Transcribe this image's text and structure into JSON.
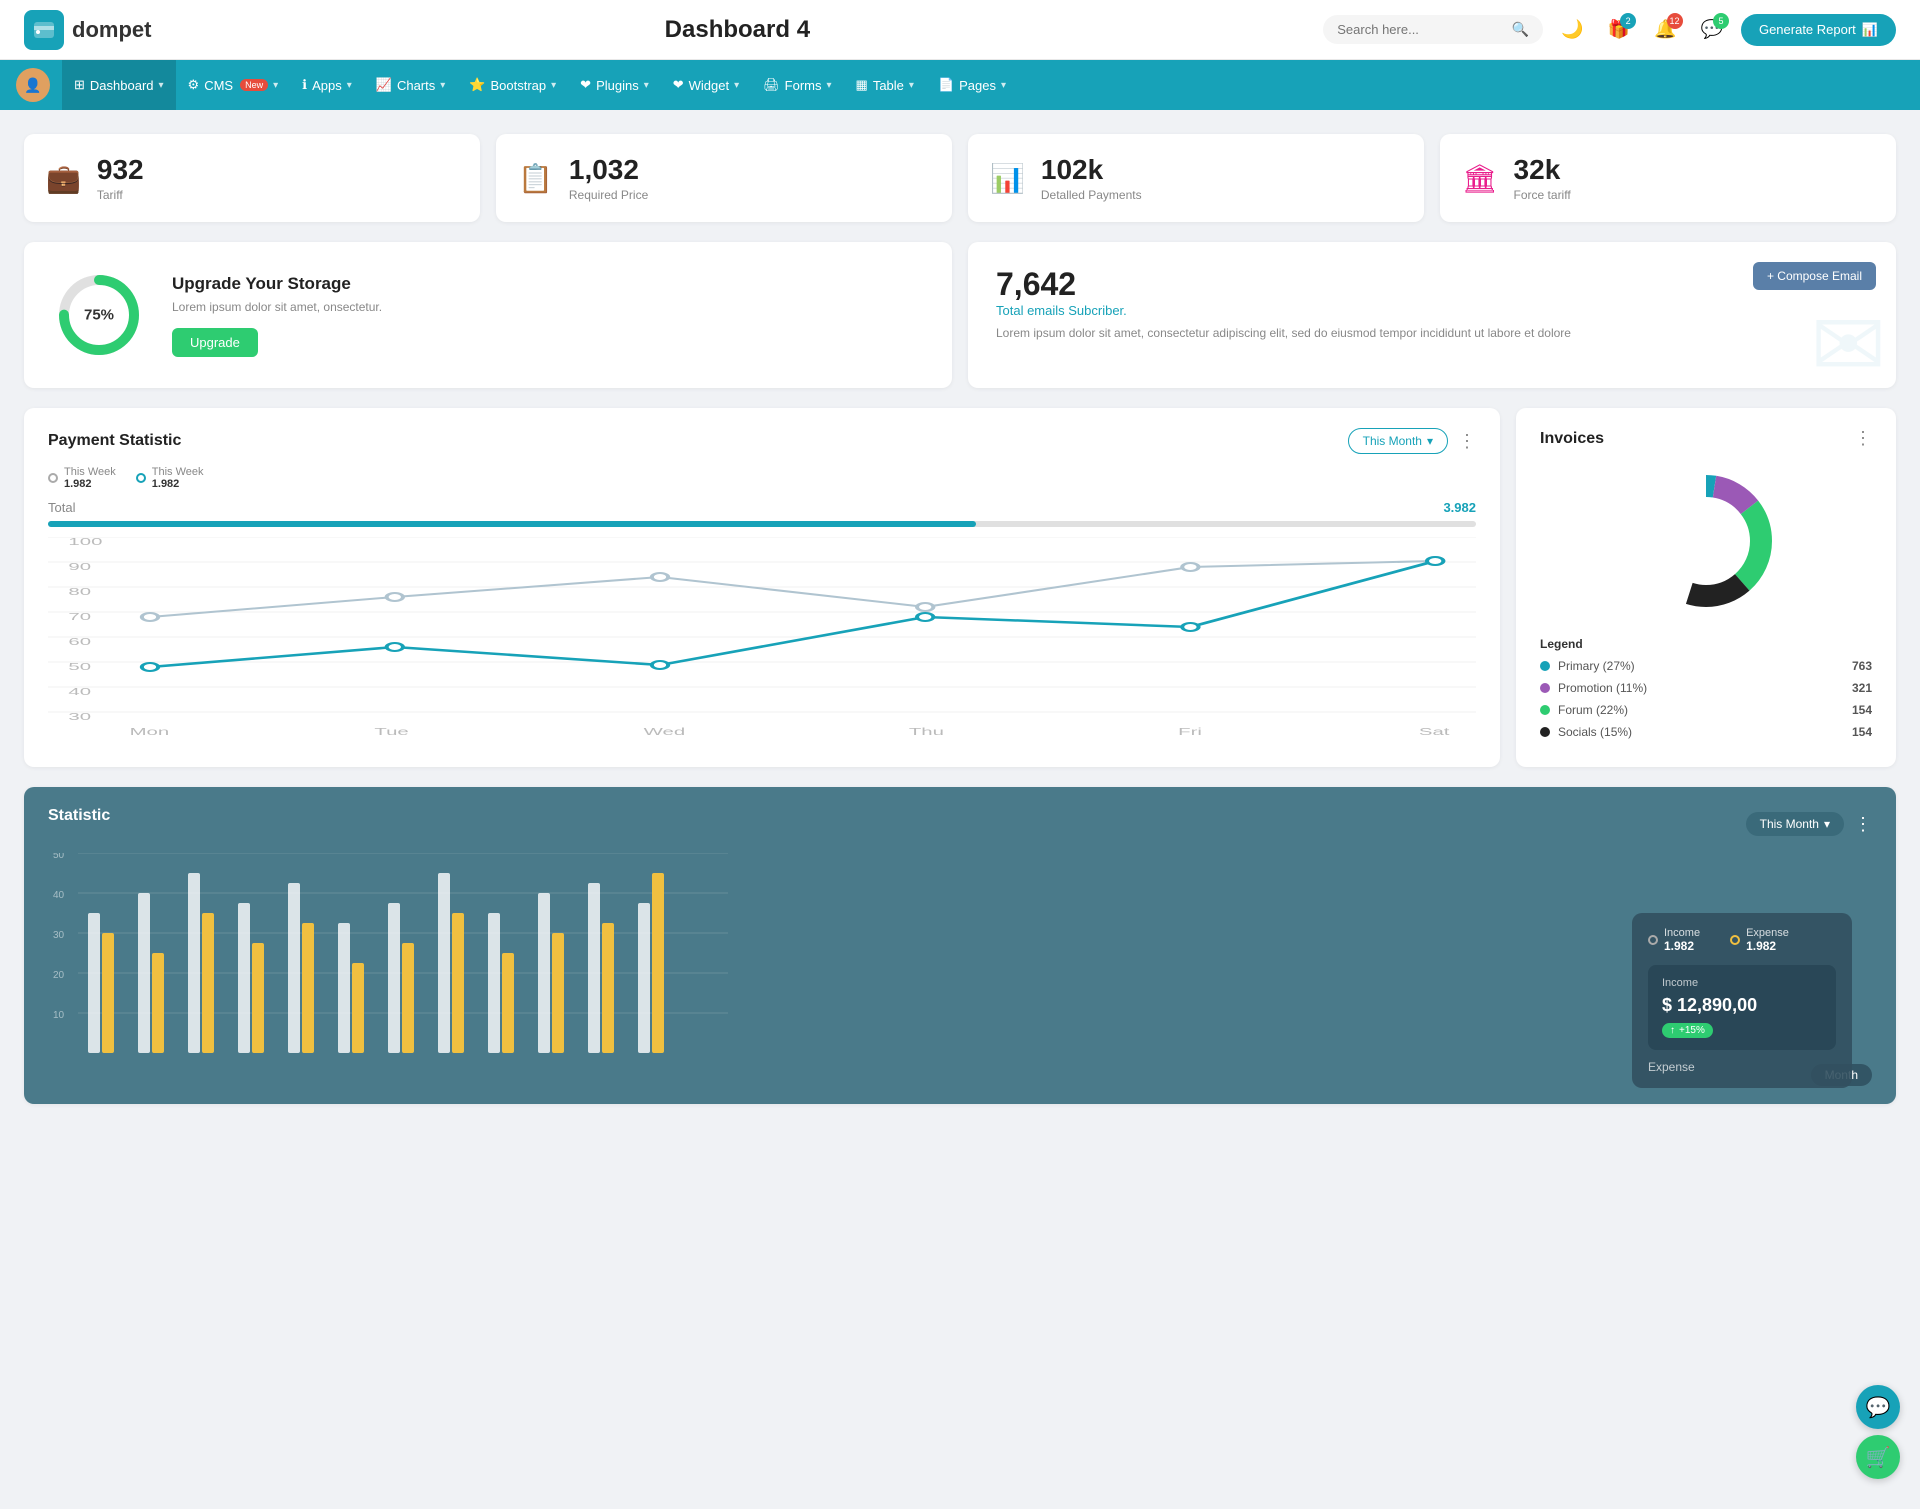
{
  "header": {
    "logo_text": "dompet",
    "page_title": "Dashboard 4",
    "search_placeholder": "Search here...",
    "generate_btn": "Generate Report",
    "icons": {
      "moon": "🌙",
      "gift": "🎁",
      "bell": "🔔",
      "chat": "💬"
    },
    "badges": {
      "gift": "2",
      "bell": "12",
      "chat": "5"
    }
  },
  "nav": {
    "items": [
      {
        "label": "Dashboard",
        "icon": "⊞",
        "active": true,
        "has_arrow": true
      },
      {
        "label": "CMS",
        "icon": "⚙",
        "badge": "New",
        "has_arrow": true
      },
      {
        "label": "Apps",
        "icon": "ℹ",
        "has_arrow": true
      },
      {
        "label": "Charts",
        "icon": "📈",
        "has_arrow": true
      },
      {
        "label": "Bootstrap",
        "icon": "⭐",
        "has_arrow": true
      },
      {
        "label": "Plugins",
        "icon": "❤",
        "has_arrow": true
      },
      {
        "label": "Widget",
        "icon": "❤",
        "has_arrow": true
      },
      {
        "label": "Forms",
        "icon": "🖨",
        "has_arrow": true
      },
      {
        "label": "Table",
        "icon": "▦",
        "has_arrow": true
      },
      {
        "label": "Pages",
        "icon": "📄",
        "has_arrow": true
      }
    ]
  },
  "stat_cards": [
    {
      "value": "932",
      "label": "Tariff",
      "icon": "💼",
      "icon_class": "teal"
    },
    {
      "value": "1,032",
      "label": "Required Price",
      "icon": "📋",
      "icon_class": "red"
    },
    {
      "value": "102k",
      "label": "Detalled Payments",
      "icon": "📊",
      "icon_class": "purple"
    },
    {
      "value": "32k",
      "label": "Force tariff",
      "icon": "🏛",
      "icon_class": "pink"
    }
  ],
  "storage": {
    "percent": 75,
    "percent_label": "75%",
    "title": "Upgrade Your Storage",
    "desc": "Lorem ipsum dolor sit amet, onsectetur.",
    "btn_label": "Upgrade"
  },
  "email": {
    "count": "7,642",
    "sub_label": "Total emails Subcriber.",
    "desc": "Lorem ipsum dolor sit amet, consectetur adipiscing elit, sed do eiusmod tempor incididunt ut labore et dolore",
    "compose_btn": "+ Compose Email"
  },
  "payment": {
    "title": "Payment Statistic",
    "this_month": "This Month",
    "legend1_label": "This Week",
    "legend1_value": "1.982",
    "legend2_label": "This Week",
    "legend2_value": "1.982",
    "total_label": "Total",
    "total_value": "3.982",
    "progress": 65,
    "x_labels": [
      "Mon",
      "Tue",
      "Wed",
      "Thu",
      "Fri",
      "Sat"
    ],
    "y_labels": [
      "100",
      "90",
      "80",
      "70",
      "60",
      "50",
      "40",
      "30"
    ],
    "line1": [
      60,
      70,
      80,
      65,
      85,
      88
    ],
    "line2": [
      40,
      50,
      42,
      68,
      62,
      88
    ]
  },
  "invoices": {
    "title": "Invoices",
    "donut": {
      "segments": [
        {
          "label": "Primary (27%)",
          "value": 763,
          "color": "#17a2b8",
          "percent": 27
        },
        {
          "label": "Promotion (11%)",
          "value": 321,
          "color": "#9b59b6",
          "percent": 11
        },
        {
          "label": "Forum (22%)",
          "value": 154,
          "color": "#2ecc71",
          "percent": 22
        },
        {
          "label": "Socials (15%)",
          "value": 154,
          "color": "#222",
          "percent": 15
        }
      ]
    },
    "legend_title": "Legend"
  },
  "statistic": {
    "title": "Statistic",
    "this_month": "This Month",
    "income_label": "Income",
    "income_value": "1.982",
    "expense_label": "Expense",
    "expense_value": "1.982",
    "y_labels": [
      "50",
      "40",
      "30",
      "20",
      "10"
    ],
    "income_box": {
      "label": "Income",
      "value": "$ 12,890,00",
      "badge": "+15%"
    },
    "expense_label2": "Expense",
    "month_label": "Month"
  },
  "floating": {
    "chat_icon": "💬",
    "shop_icon": "🛒"
  }
}
